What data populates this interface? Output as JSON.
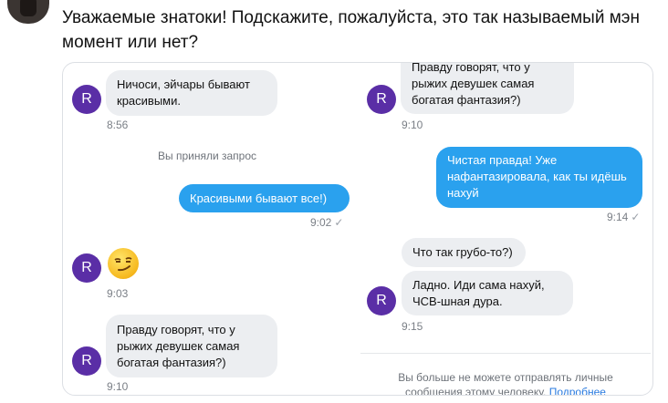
{
  "post": {
    "text": "Уважаемые знатоки! Подскажите, пожалуйста, это так называемый мэн момент или нет?"
  },
  "left": {
    "msg1": "Ничоси, эйчары бывают красивыми.",
    "time1": "8:56",
    "system": "Вы приняли запрос",
    "out1": "Красивыми бывают все!)",
    "out1_time": "9:02",
    "emoji_time": "9:03",
    "msg2": "Правду говорят, что у рыжих девушек самая богатая фантазия?)",
    "time2": "9:10"
  },
  "right": {
    "msg_top": "Правду говорят, что у рыжих девушек самая богатая фантазия?)",
    "time_top": "9:10",
    "out1": "Чистая правда! Уже нафантазировала, как ты идёшь нахуй",
    "out1_time": "9:14",
    "msg2": "Что так грубо-то?)",
    "msg3": "Ладно. Иди сама нахуй, ЧСВ-шная дура.",
    "time3": "9:15",
    "notice": "Вы больше не можете отправлять личные сообщения этому человеку.",
    "notice_link": "Подробнее"
  },
  "avatar_letter": "R",
  "check_mark": "✓",
  "colors": {
    "avatar": "#5a2ea6",
    "outgoing": "#2aa1ee",
    "incoming": "#eceef1",
    "link": "#2a7be0"
  },
  "icons": [
    "smirk-emoji-icon",
    "read-check-icon"
  ]
}
